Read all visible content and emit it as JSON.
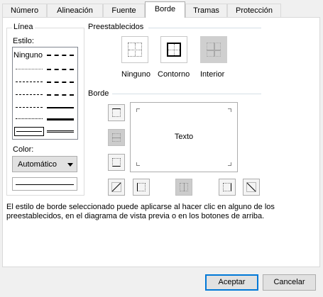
{
  "tabs": [
    {
      "label": "Número"
    },
    {
      "label": "Alineación"
    },
    {
      "label": "Fuente"
    },
    {
      "label": "Borde"
    },
    {
      "label": "Tramas"
    },
    {
      "label": "Protección"
    }
  ],
  "active_tab": "Borde",
  "line_group": {
    "title": "Línea",
    "style_label": "Estilo:",
    "none_label": "Ninguno",
    "color_label": "Color:",
    "color_value": "Automático",
    "line_color": "#000000"
  },
  "presets": {
    "title": "Preestablecidos",
    "items": [
      {
        "label": "Ninguno",
        "enabled": true
      },
      {
        "label": "Contorno",
        "enabled": true
      },
      {
        "label": "Interior",
        "enabled": false
      }
    ]
  },
  "border": {
    "title": "Borde",
    "preview_text": "Texto"
  },
  "description": "El estilo de borde seleccionado puede aplicarse al hacer clic en alguno de los\npreestablecidos, en el diagrama de vista previa o en los botones de arriba.",
  "buttons": {
    "ok": "Aceptar",
    "cancel": "Cancelar"
  },
  "colors": {
    "accent": "#0078d7",
    "panel_bg": "#ffffff",
    "dialog_bg": "#f0f0f0"
  }
}
